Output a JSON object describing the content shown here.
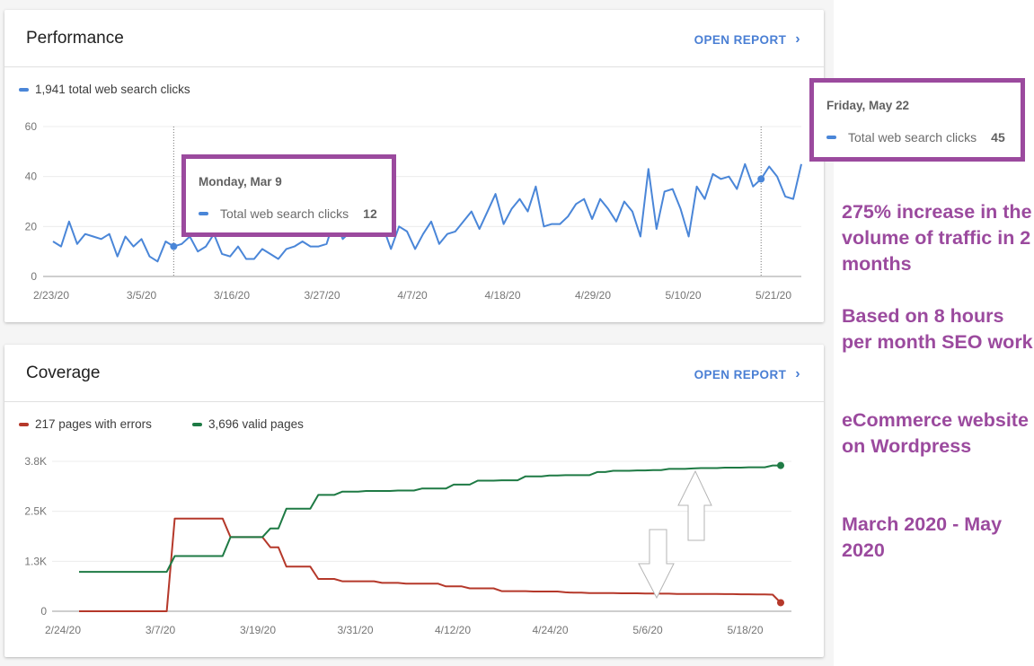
{
  "performance": {
    "title": "Performance",
    "open_report": "OPEN REPORT",
    "legend": "1,941 total web search clicks",
    "tooltip_start": {
      "date": "Monday, Mar 9",
      "label": "Total web search clicks",
      "value": "12"
    },
    "tooltip_end": {
      "date": "Friday, May 22",
      "label": "Total web search clicks",
      "value": "45"
    }
  },
  "coverage": {
    "title": "Coverage",
    "open_report": "OPEN REPORT",
    "legend_errors": "217 pages with errors",
    "legend_valid": "3,696 valid pages"
  },
  "annotations": [
    "275% increase in the volume of traffic in 2 months",
    "Based on 8 hours per month SEO work",
    "eCommerce website on Wordpress",
    "March 2020 - May 2020"
  ],
  "colors": {
    "clicks": "#4a86d8",
    "errors": "#b5382a",
    "valid": "#1e7a44",
    "highlight": "#9b4a9e",
    "link": "#4a7fd4"
  },
  "chart_data": [
    {
      "type": "line",
      "title": "Performance",
      "xlabel": "",
      "ylabel": "",
      "ylim": [
        0,
        60
      ],
      "yticks": [
        "0",
        "20",
        "40",
        "60"
      ],
      "xticks": [
        "2/23/20",
        "3/5/20",
        "3/16/20",
        "3/27/20",
        "4/7/20",
        "4/18/20",
        "4/29/20",
        "5/10/20",
        "5/21/20"
      ],
      "x_start": "2/23/20",
      "x_end": "5/22/20",
      "grid": true,
      "legend": "top-left",
      "series": [
        {
          "name": "Total web search clicks",
          "values": [
            14,
            12,
            22,
            13,
            17,
            16,
            15,
            17,
            8,
            16,
            12,
            15,
            8,
            6,
            14,
            12,
            13,
            16,
            10,
            12,
            17,
            9,
            8,
            12,
            7,
            7,
            11,
            9,
            7,
            11,
            12,
            14,
            12,
            12,
            13,
            23,
            15,
            18,
            26,
            21,
            25,
            20,
            11,
            20,
            18,
            11,
            17,
            22,
            13,
            17,
            18,
            22,
            26,
            19,
            26,
            33,
            21,
            27,
            31,
            26,
            36,
            20,
            21,
            21,
            24,
            29,
            31,
            23,
            31,
            27,
            22,
            30,
            26,
            16,
            43,
            19,
            34,
            35,
            27,
            16,
            36,
            31,
            41,
            39,
            40,
            35,
            45,
            36,
            39,
            44,
            40,
            32,
            31,
            45
          ],
          "highlighted_points": [
            {
              "x": "3/9/20",
              "y": 12
            },
            {
              "x": "5/22/20",
              "y": 45
            }
          ]
        }
      ]
    },
    {
      "type": "line",
      "title": "Coverage",
      "xlabel": "",
      "ylabel": "",
      "ylim": [
        0,
        3800
      ],
      "yticks": [
        "0",
        "1.3K",
        "2.5K",
        "3.8K"
      ],
      "xticks": [
        "2/24/20",
        "3/7/20",
        "3/19/20",
        "3/31/20",
        "4/12/20",
        "4/24/20",
        "5/6/20",
        "5/18/20"
      ],
      "x_start": "2/24/20",
      "x_end": "5/22/20",
      "grid": true,
      "legend": "top-left",
      "series": [
        {
          "name": "Pages with errors",
          "values": [
            0,
            0,
            0,
            0,
            0,
            0,
            0,
            0,
            0,
            0,
            0,
            0,
            2350,
            2350,
            2350,
            2350,
            2350,
            2350,
            2350,
            1880,
            1880,
            1880,
            1880,
            1880,
            1620,
            1620,
            1130,
            1130,
            1130,
            1130,
            820,
            820,
            820,
            760,
            760,
            760,
            760,
            760,
            720,
            720,
            720,
            700,
            700,
            700,
            700,
            700,
            630,
            630,
            630,
            580,
            580,
            580,
            580,
            510,
            510,
            510,
            510,
            500,
            500,
            500,
            500,
            480,
            470,
            470,
            460,
            460,
            460,
            460,
            455,
            455,
            455,
            450,
            450,
            445,
            445,
            440,
            440,
            440,
            440,
            440,
            440,
            435,
            435,
            430,
            430,
            425,
            425,
            420,
            217
          ],
          "last_value": 217
        },
        {
          "name": "Valid pages",
          "values": [
            1000,
            1000,
            1000,
            1000,
            1000,
            1000,
            1000,
            1000,
            1000,
            1000,
            1000,
            1000,
            1400,
            1400,
            1400,
            1400,
            1400,
            1400,
            1400,
            1880,
            1880,
            1880,
            1880,
            1880,
            2100,
            2100,
            2600,
            2600,
            2600,
            2600,
            2950,
            2950,
            2950,
            3030,
            3030,
            3030,
            3050,
            3050,
            3050,
            3050,
            3060,
            3060,
            3060,
            3110,
            3110,
            3110,
            3110,
            3210,
            3210,
            3210,
            3310,
            3310,
            3310,
            3320,
            3320,
            3320,
            3420,
            3420,
            3420,
            3440,
            3440,
            3450,
            3450,
            3450,
            3450,
            3530,
            3530,
            3560,
            3560,
            3560,
            3570,
            3570,
            3580,
            3580,
            3610,
            3610,
            3610,
            3620,
            3630,
            3630,
            3630,
            3640,
            3640,
            3640,
            3650,
            3650,
            3650,
            3696,
            3696
          ],
          "last_value": 3696
        }
      ]
    }
  ]
}
